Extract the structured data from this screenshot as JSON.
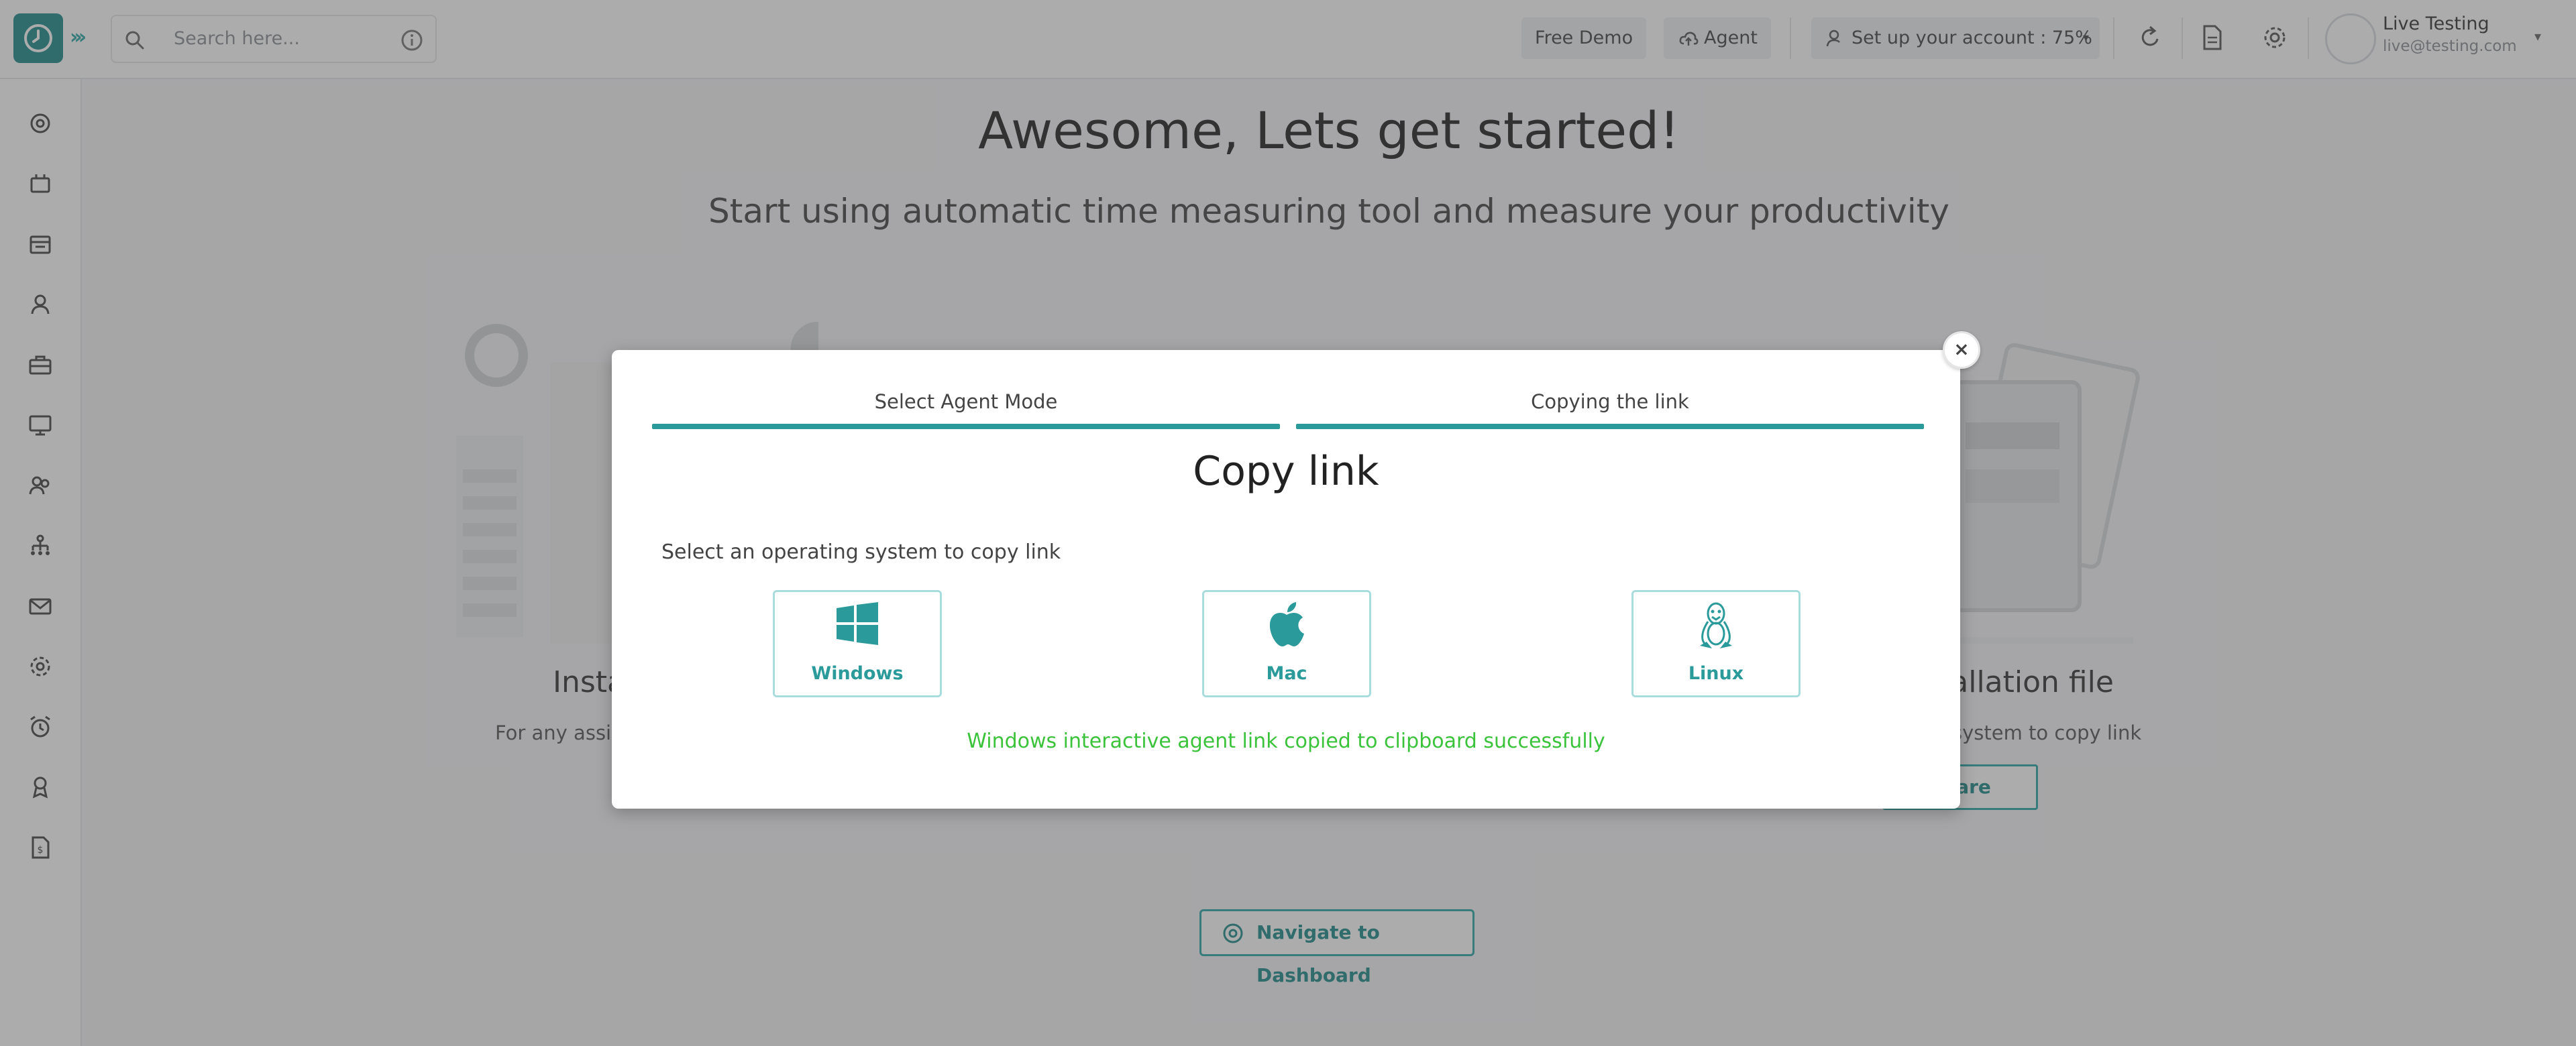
{
  "topbar": {
    "search_placeholder": "Search here...",
    "free_demo_label": "Free Demo",
    "agent_label": "Agent",
    "setup_label": "Set up your account : 75%",
    "setup_progress": 0.75,
    "user_name": "Live Testing",
    "user_email": "live@testing.com"
  },
  "sidebar": {
    "items": [
      "dashboard",
      "timesheets",
      "calendar",
      "employee",
      "projects",
      "monitoring",
      "team",
      "organization",
      "messages",
      "settings",
      "alarms",
      "awards",
      "reports"
    ]
  },
  "background": {
    "title": "Awesome, Lets get started!",
    "subtitle": "Start using automatic time measuring tool and measure your productivity",
    "card_left_title": "Insta",
    "card_left_text": "For any assi",
    "card_right_title": "tallation file",
    "card_right_text": "system to copy link",
    "share_label": "Share",
    "navigate_label": "Navigate to Dashboard"
  },
  "modal": {
    "step1_label": "Select Agent Mode",
    "step2_label": "Copying the link",
    "title": "Copy link",
    "instruction": "Select an operating system to copy link",
    "os_options": [
      {
        "label": "Windows"
      },
      {
        "label": "Mac"
      },
      {
        "label": "Linux"
      }
    ],
    "success_message": "Windows interactive agent link copied to clipboard successfully",
    "close_label": "×"
  },
  "colors": {
    "accent": "#2b9a9a",
    "brand": "#1f8a8a",
    "success": "#3cc33c"
  }
}
